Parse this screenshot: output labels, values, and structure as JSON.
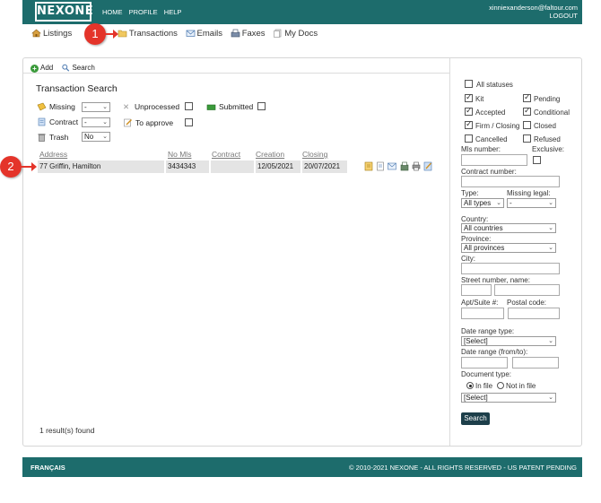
{
  "header": {
    "logo": "NEXONE",
    "nav": [
      "HOME",
      "PROFILE",
      "HELP"
    ],
    "user_email": "xinniexanderson@faltour.com",
    "logout": "LOGOUT"
  },
  "subnav": {
    "listings": "Listings",
    "transactions": "Transactions",
    "emails": "Emails",
    "faxes": "Faxes",
    "mydocs": "My Docs"
  },
  "toolbar": {
    "add": "Add",
    "search": "Search"
  },
  "page_title": "Transaction Search",
  "filters": {
    "missing": {
      "label": "Missing",
      "value": "-"
    },
    "contract": {
      "label": "Contract",
      "value": "-"
    },
    "trash": {
      "label": "Trash",
      "value": "No"
    },
    "unprocessed": "Unprocessed",
    "submitted": "Submitted",
    "to_approve": "To approve"
  },
  "table": {
    "headers": [
      "Address",
      "No Mls",
      "Contract",
      "Creation",
      "Closing"
    ],
    "rows": [
      {
        "address": "77 Griffin, Hamilton",
        "no_mls": "3434343",
        "contract": "",
        "creation": "12/05/2021",
        "closing": "20/07/2021"
      }
    ]
  },
  "results_text": "1 result(s) found",
  "right": {
    "all_statuses": "All statuses",
    "kit": "Kit",
    "pending": "Pending",
    "accepted": "Accepted",
    "conditional": "Conditional",
    "firm_closing": "Firm / Closing",
    "closed": "Closed",
    "cancelled": "Cancelled",
    "refused": "Refused",
    "mls_number": "Mls number:",
    "exclusive": "Exclusive:",
    "contract_number": "Contract number:",
    "type": {
      "label": "Type:",
      "value": "All types"
    },
    "missing_legal": {
      "label": "Missing legal:",
      "value": "-"
    },
    "country": {
      "label": "Country:",
      "value": "All countries"
    },
    "province": {
      "label": "Province:",
      "value": "All provinces"
    },
    "city": "City:",
    "street": "Street number, name:",
    "apt": "Apt/Suite #:",
    "postal": "Postal code:",
    "date_range_type": {
      "label": "Date range type:",
      "value": "[Select]"
    },
    "date_range": "Date range (from/to):",
    "document_type": {
      "label": "Document type:",
      "value": "[Select]"
    },
    "in_file": "In file",
    "not_in_file": "Not in file",
    "search": "Search"
  },
  "footer": {
    "language": "FRANÇAIS",
    "copyright": "© 2010-2021 NEXONE - ALL RIGHTS RESERVED - US PATENT PENDING"
  },
  "callouts": [
    "1",
    "2"
  ],
  "colors": {
    "brand": "#1d6c6c",
    "callout": "#e4342a",
    "search_button": "#1d3f4a"
  }
}
